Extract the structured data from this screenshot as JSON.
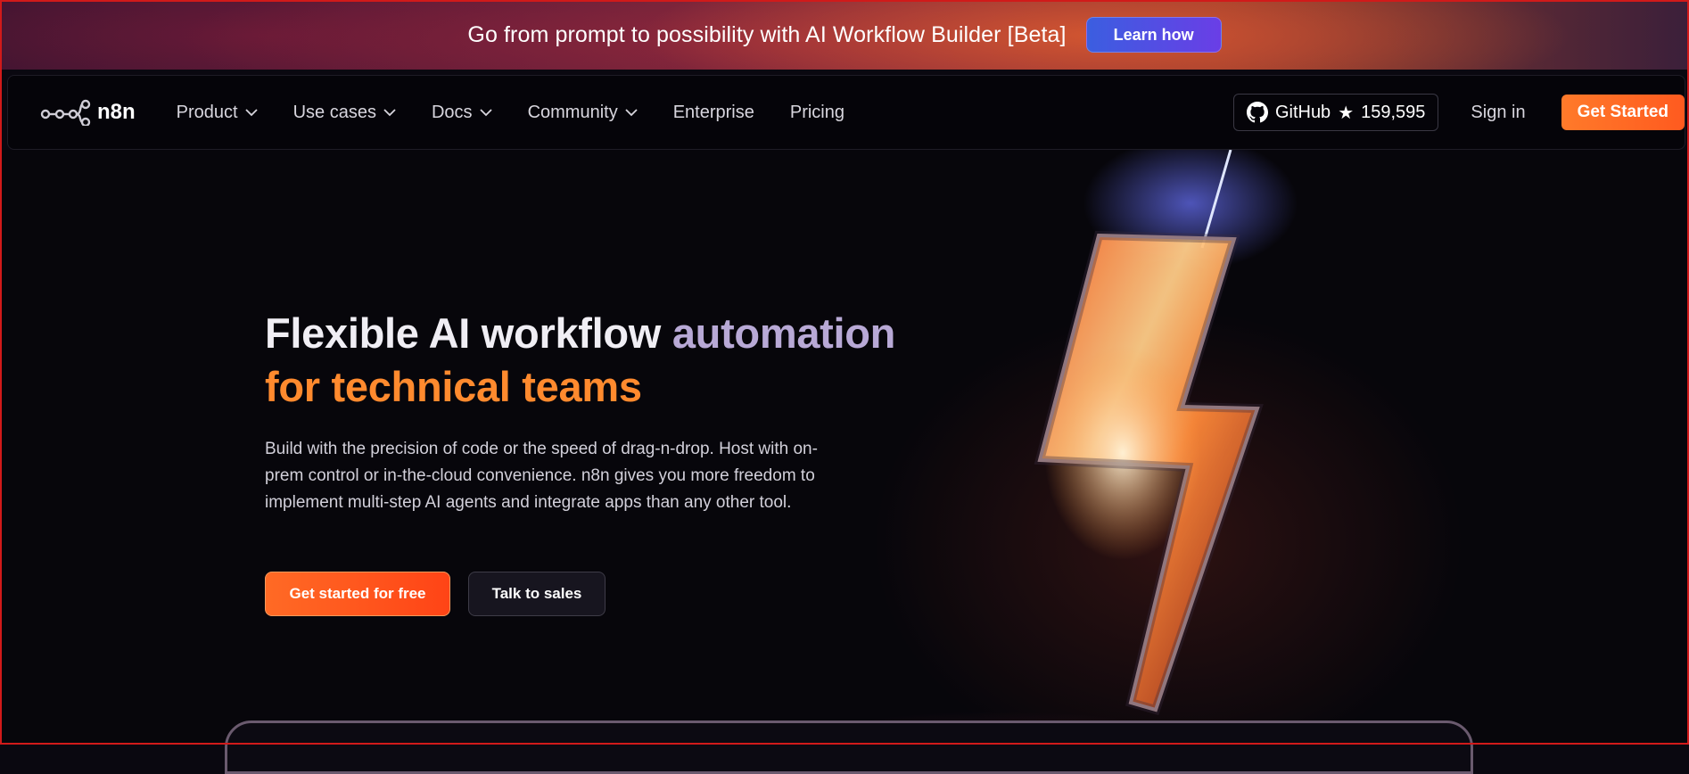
{
  "banner": {
    "text": "Go from prompt to possibility with AI Workflow Builder [Beta]",
    "button": "Learn how"
  },
  "nav": {
    "logo_text": "n8n",
    "links": [
      {
        "label": "Product",
        "dropdown": true
      },
      {
        "label": "Use cases",
        "dropdown": true
      },
      {
        "label": "Docs",
        "dropdown": true
      },
      {
        "label": "Community",
        "dropdown": true
      },
      {
        "label": "Enterprise",
        "dropdown": false
      },
      {
        "label": "Pricing",
        "dropdown": false
      }
    ],
    "github": {
      "label": "GitHub",
      "star": "★",
      "count": "159,595"
    },
    "signin": "Sign in",
    "get_started": "Get Started"
  },
  "hero": {
    "title_part1": "Flexible AI workflow ",
    "title_part2": "automation",
    "title_line2": "for technical teams",
    "description": "Build with the precision of code or the speed of drag-n-drop. Host with on-prem control or in-the-cloud convenience. n8n gives you more freedom to implement multi-step AI agents and integrate apps than any other tool.",
    "cta_primary": "Get started for free",
    "cta_secondary": "Talk to sales"
  },
  "colors": {
    "accent_orange": "#ff8a2e",
    "banner_button": "#4a4ee4",
    "background": "#07060b"
  }
}
